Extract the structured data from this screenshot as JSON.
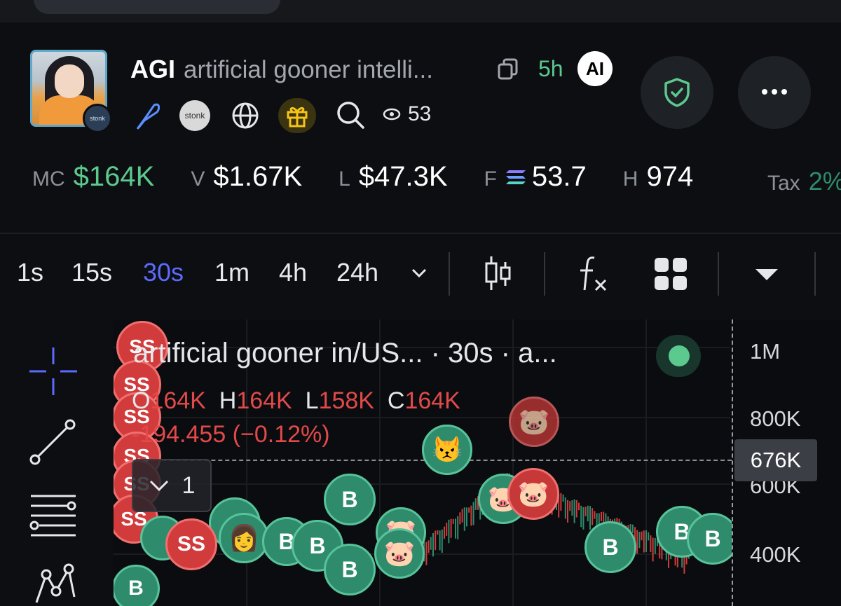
{
  "token": {
    "ticker": "AGI",
    "name": "artificial gooner intelli...",
    "age": "5h",
    "ai_badge": "AI",
    "avatar_badge": "stonk",
    "views": "53",
    "stonk_label": "stonk"
  },
  "stats": [
    {
      "label": "MC",
      "value": "$164K",
      "green": true
    },
    {
      "label": "V",
      "value": "$1.67K",
      "green": false
    },
    {
      "label": "L",
      "value": "$47.3K",
      "green": false
    },
    {
      "label": "F",
      "value": "53.7",
      "green": false,
      "sol": true
    },
    {
      "label": "H",
      "value": "974",
      "green": false
    }
  ],
  "tax": {
    "label": "Tax",
    "value": "2%"
  },
  "timeframes": [
    "1s",
    "15s",
    "30s",
    "1m",
    "4h",
    "24h"
  ],
  "active_timeframe": "30s",
  "chart": {
    "legend_title": "artificial gooner in/US... · 30s · a...",
    "open_label": "O",
    "open": "164K",
    "high_label": "H",
    "high": "164K",
    "low_label": "L",
    "low": "158K",
    "close_label": "C",
    "close": "164K",
    "change": "-194.455 (−0.12%)",
    "collapsed_count": "1",
    "price_labels": [
      "1M",
      "800K",
      "600K",
      "400K"
    ],
    "current_price": "676K",
    "bubble_buy": "B",
    "bubble_sell": "SS"
  },
  "colors": {
    "accent": "#5b6bff",
    "green": "#5cc98e",
    "red": "#e24a4a"
  }
}
